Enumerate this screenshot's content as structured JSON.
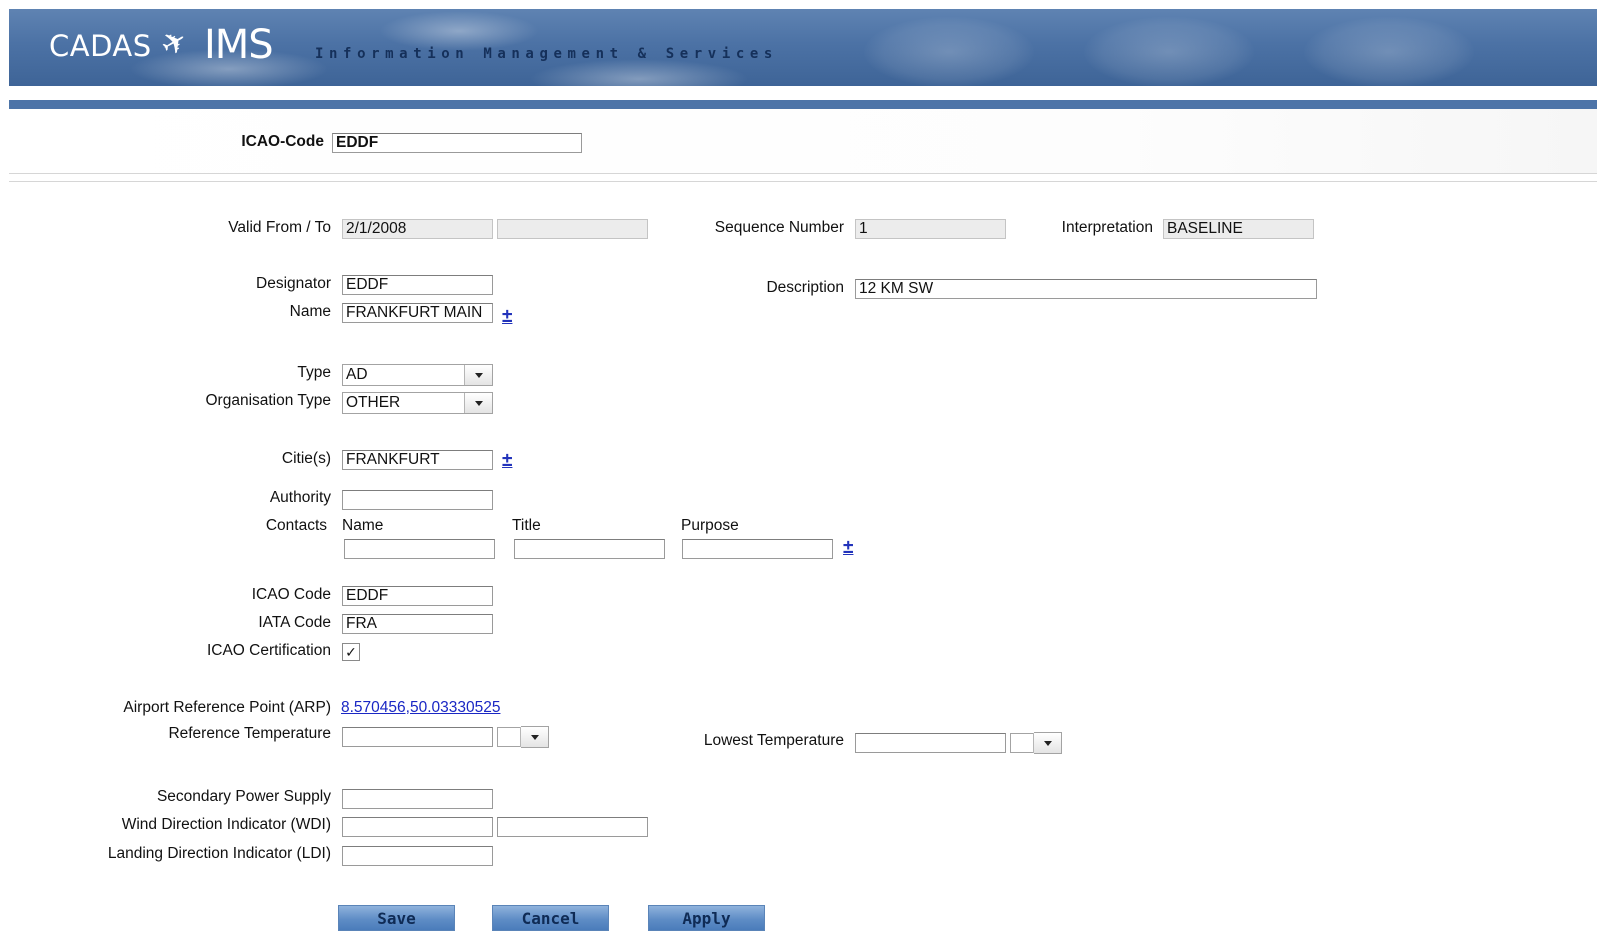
{
  "header": {
    "brand_cadas": "CADAS",
    "brand_ims": "IMS",
    "tagline": "Information Management & Services"
  },
  "search": {
    "icao_label": "ICAO-Code",
    "icao_value": "EDDF"
  },
  "form": {
    "valid_label": "Valid From / To",
    "valid_from": "2/1/2008",
    "valid_to": "",
    "sequence_label": "Sequence Number",
    "sequence_value": "1",
    "interpretation_label": "Interpretation",
    "interpretation_value": "BASELINE",
    "designator_label": "Designator",
    "designator_value": "EDDF",
    "name_label": "Name",
    "name_value": "FRANKFURT MAIN",
    "description_label": "Description",
    "description_value": "12 KM SW",
    "type_label": "Type",
    "type_value": "AD",
    "org_type_label": "Organisation Type",
    "org_type_value": "OTHER",
    "cities_label": "Citie(s)",
    "cities_value": "FRANKFURT",
    "authority_label": "Authority",
    "authority_value": "",
    "contacts_label": "Contacts",
    "contacts_name_header": "Name",
    "contacts_title_header": "Title",
    "contacts_purpose_header": "Purpose",
    "contact_name": "",
    "contact_title": "",
    "contact_purpose": "",
    "icao_code_label": "ICAO Code",
    "icao_code_value": "EDDF",
    "iata_code_label": "IATA Code",
    "iata_code_value": "FRA",
    "icao_cert_label": "ICAO Certification",
    "icao_cert_checked": "✓",
    "arp_label": "Airport Reference Point (ARP)",
    "arp_value": "8.570456,50.03330525",
    "ref_temp_label": "Reference Temperature",
    "ref_temp_value": "",
    "lowest_temp_label": "Lowest Temperature",
    "lowest_temp_value": "",
    "secondary_power_label": "Secondary Power Supply",
    "secondary_power_value": "",
    "wdi_label": "Wind Direction Indicator (WDI)",
    "wdi_value_1": "",
    "wdi_value_2": "",
    "ldi_label": "Landing Direction Indicator (LDI)",
    "ldi_value": "",
    "add_symbol": "±"
  },
  "actions": {
    "save": "Save",
    "cancel": "Cancel",
    "apply": "Apply"
  },
  "colors": {
    "header_blue": "#4c72a5",
    "link_blue": "#1a27c4",
    "button_blue": "#5f8dc6"
  }
}
